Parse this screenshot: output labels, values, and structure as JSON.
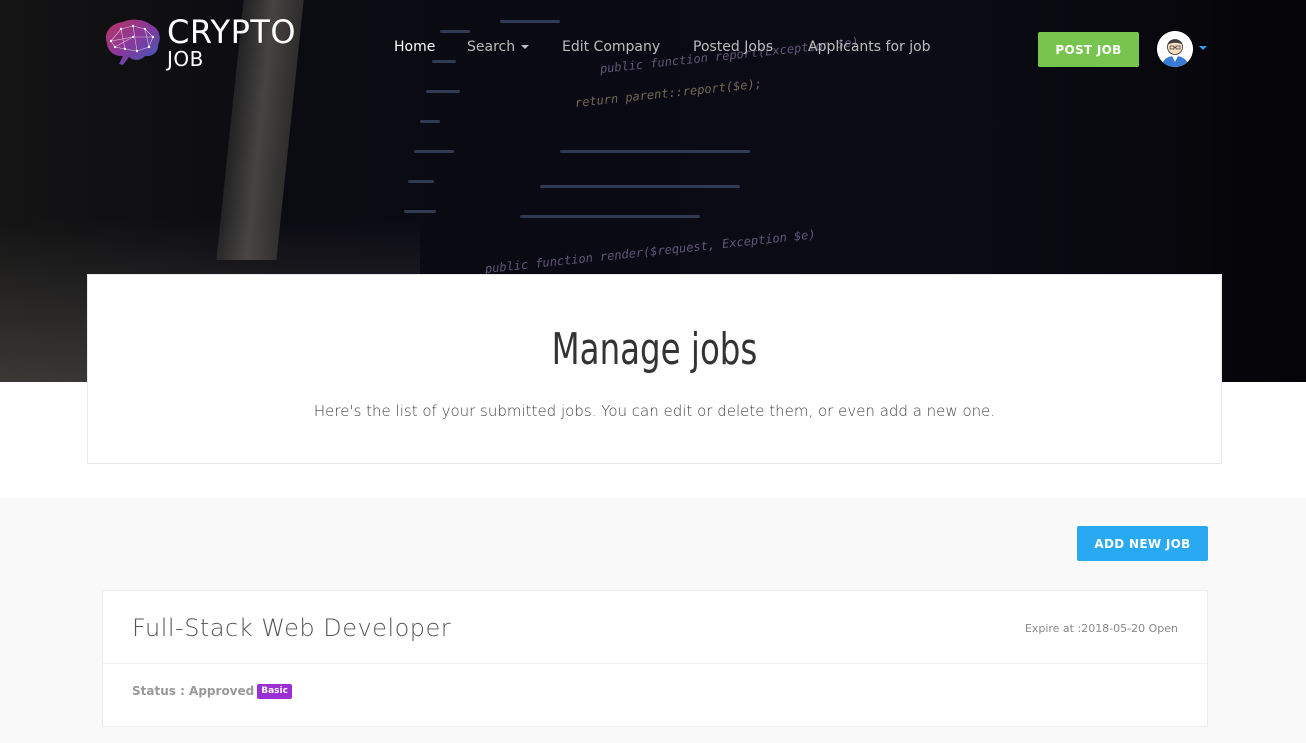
{
  "brand": {
    "word1": "CRYPTO",
    "word2": "JOB"
  },
  "nav": {
    "items": [
      {
        "label": "Home",
        "active": true
      },
      {
        "label": "Search",
        "has_dropdown": true
      },
      {
        "label": "Edit Company"
      },
      {
        "label": "Posted Jobs"
      },
      {
        "label": "Applicants for job"
      }
    ],
    "post_job_label": "POST JOB",
    "avatar_icon": "user-avatar-icon"
  },
  "hero": {
    "code_fragments": [
      "public function report(Exception $e)",
      "return parent::report($e);",
      "public function render($request, Exception $e)"
    ]
  },
  "header": {
    "title": "Manage jobs",
    "subtitle": "Here's the list of your submitted jobs. You can edit or delete them, or even add a new one."
  },
  "actions": {
    "add_new_job_label": "ADD NEW JOB"
  },
  "jobs": [
    {
      "title": "Full-Stack Web Developer",
      "expire": "Expire at :2018-05-20 Open",
      "status_label": "Status : Approved",
      "badge": "Basic"
    }
  ],
  "colors": {
    "post_job": "#77c54f",
    "add_job": "#29a9f2",
    "badge": "#9b2fd6",
    "avatar_caret": "#2e9bf0"
  }
}
